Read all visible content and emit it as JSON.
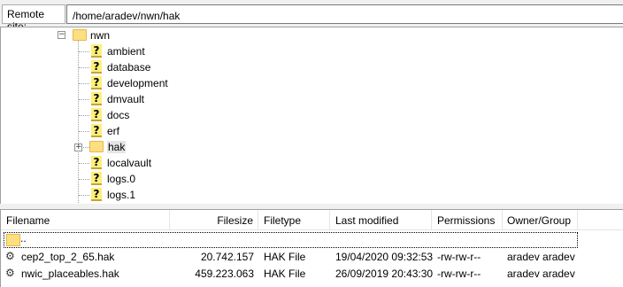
{
  "site_bar": {
    "label": "Remote site:",
    "path": "/home/aradev/nwn/hak"
  },
  "tree": {
    "root": {
      "label": "nwn",
      "expander": "−"
    },
    "children": [
      {
        "label": "ambient",
        "icon": "unknown-folder-icon"
      },
      {
        "label": "database",
        "icon": "unknown-folder-icon"
      },
      {
        "label": "development",
        "icon": "unknown-folder-icon"
      },
      {
        "label": "dmvault",
        "icon": "unknown-folder-icon"
      },
      {
        "label": "docs",
        "icon": "unknown-folder-icon"
      },
      {
        "label": "erf",
        "icon": "unknown-folder-icon"
      },
      {
        "label": "hak",
        "icon": "folder-icon",
        "selected": true,
        "expander": "+"
      },
      {
        "label": "localvault",
        "icon": "unknown-folder-icon"
      },
      {
        "label": "logs.0",
        "icon": "unknown-folder-icon"
      },
      {
        "label": "logs.1",
        "icon": "unknown-folder-icon"
      }
    ]
  },
  "filelist": {
    "columns": [
      "Filename",
      "Filesize",
      "Filetype",
      "Last modified",
      "Permissions",
      "Owner/Group"
    ],
    "parent_entry": "..",
    "rows": [
      {
        "name": "cep2_top_2_65.hak",
        "size": "20.742.157",
        "type": "HAK File",
        "modified": "19/04/2020 09:32:53",
        "perms": "-rw-rw-r--",
        "owner": "aradev aradev"
      },
      {
        "name": "nwic_placeables.hak",
        "size": "459.223.063",
        "type": "HAK File",
        "modified": "26/09/2019 20:43:30",
        "perms": "-rw-rw-r--",
        "owner": "aradev aradev"
      }
    ]
  }
}
